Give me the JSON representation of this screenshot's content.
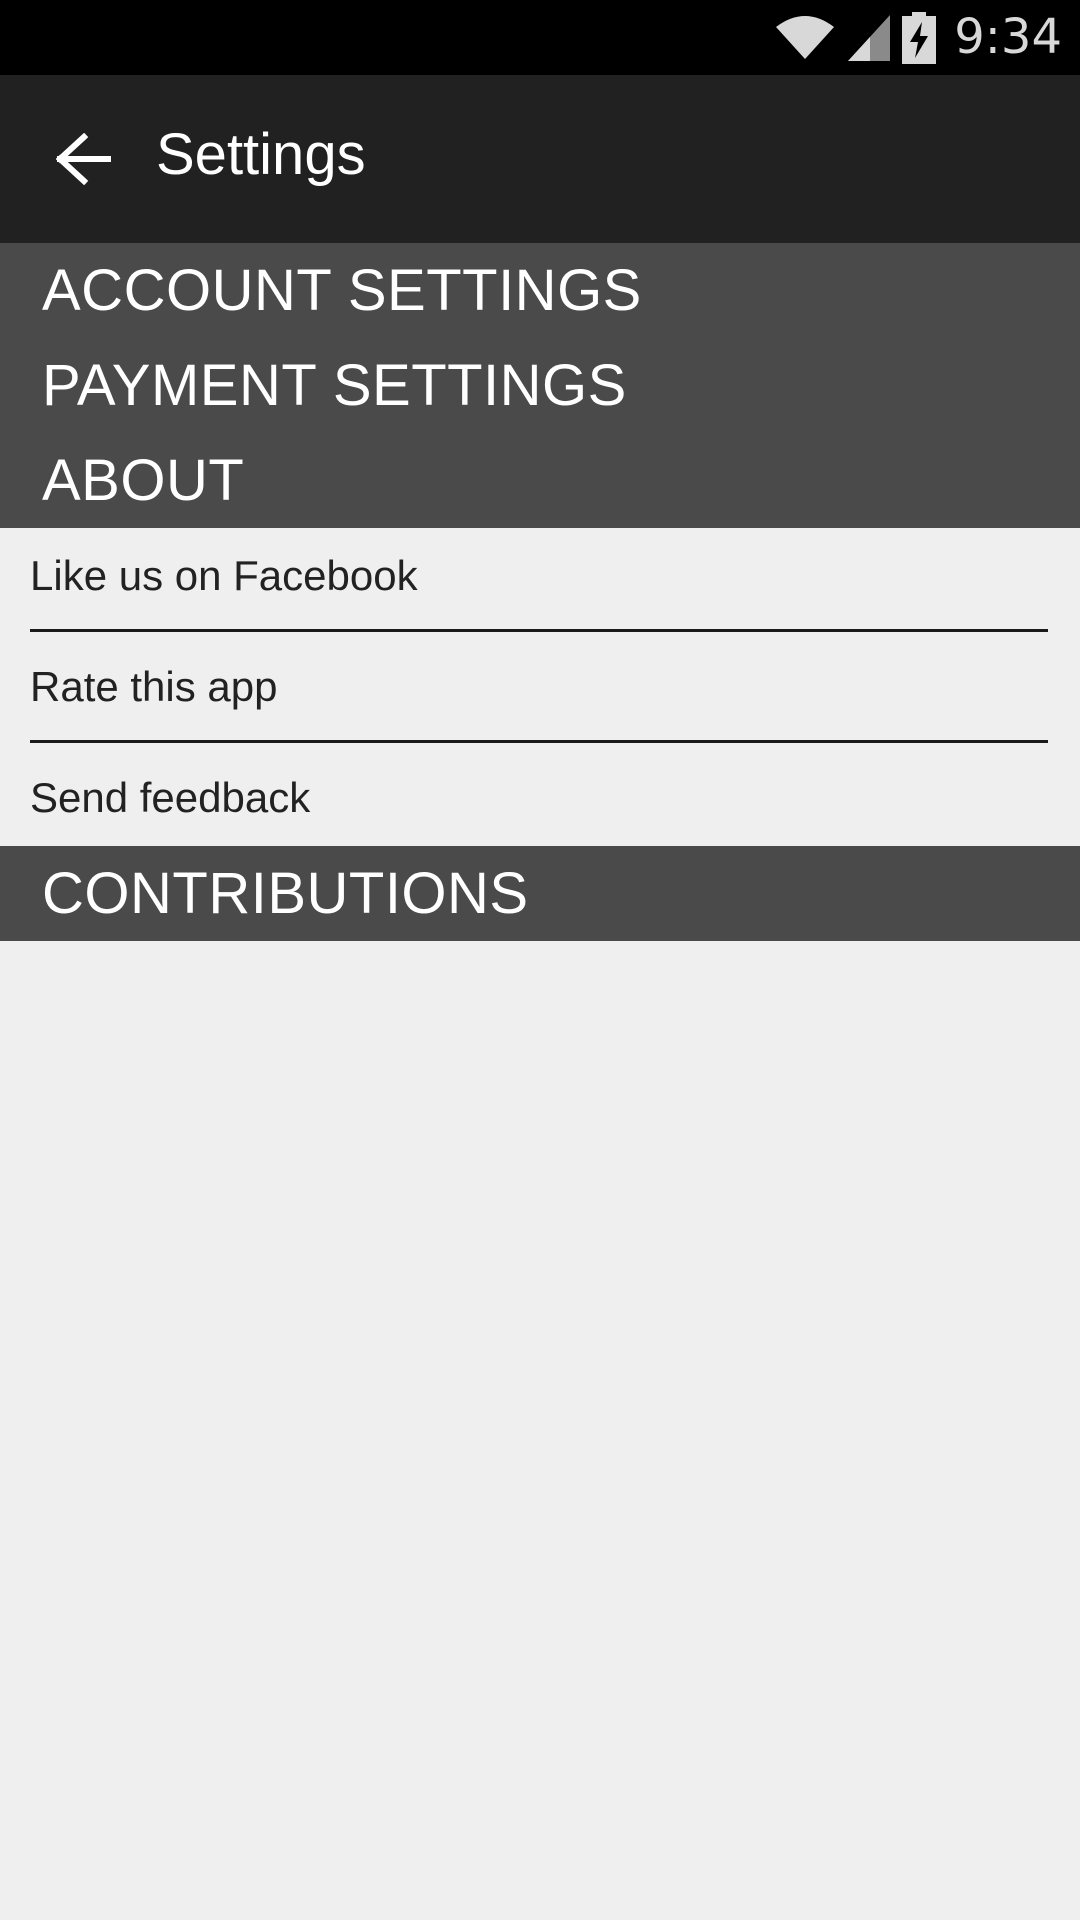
{
  "status_bar": {
    "time": "9:34",
    "icons": [
      "wifi-icon",
      "cell-signal-icon",
      "battery-charging-icon"
    ]
  },
  "app_bar": {
    "back_icon": "arrow-back-icon",
    "title": "Settings"
  },
  "sections": {
    "account": "ACCOUNT SETTINGS",
    "payment": "PAYMENT SETTINGS",
    "about": "ABOUT",
    "contributions": "CONTRIBUTIONS"
  },
  "about_items": [
    "Like us on Facebook",
    "Rate this app",
    "Send feedback"
  ],
  "colors": {
    "status_bar": "#000000",
    "app_bar": "#212121",
    "section_header": "#4a4a4a",
    "background": "#efefef"
  }
}
